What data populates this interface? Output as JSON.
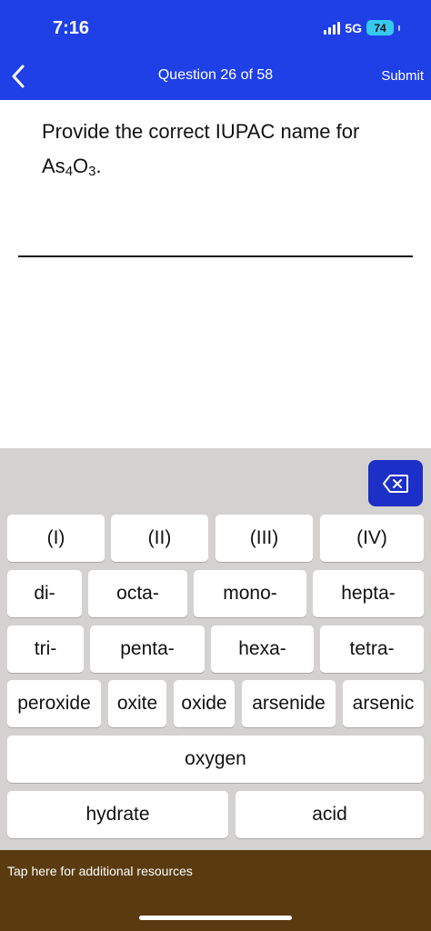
{
  "status_bar": {
    "time": "7:16",
    "network": "5G",
    "battery": "74"
  },
  "header": {
    "title": "Question 26 of 58",
    "submit_label": "Submit"
  },
  "question": {
    "prompt": "Provide the correct IUPAC name for",
    "formula_base": "As",
    "subscript_1": "4",
    "formula_mid": "O",
    "subscript_2": "3",
    "formula_end": "."
  },
  "keyboard": {
    "row1": [
      "(I)",
      "(II)",
      "(III)",
      "(IV)"
    ],
    "row2": [
      "di-",
      "octa-",
      "mono-",
      "hepta-"
    ],
    "row3": [
      "tri-",
      "penta-",
      "hexa-",
      "tetra-"
    ],
    "row4": [
      "peroxide",
      "oxite",
      "oxide",
      "arsenide",
      "arsenic"
    ],
    "row5": [
      "oxygen"
    ],
    "row6": [
      "hydrate",
      "acid"
    ]
  },
  "footer": {
    "resources_label": "Tap here for additional resources"
  },
  "colors": {
    "header": "#1f40e6",
    "backspace": "#1c2fc7",
    "keyboard_bg": "#d4d2d1",
    "footer": "#5a3b10",
    "battery": "#36c9f2"
  },
  "icons": [
    "back-chevron",
    "backspace",
    "signal-bars",
    "battery"
  ]
}
